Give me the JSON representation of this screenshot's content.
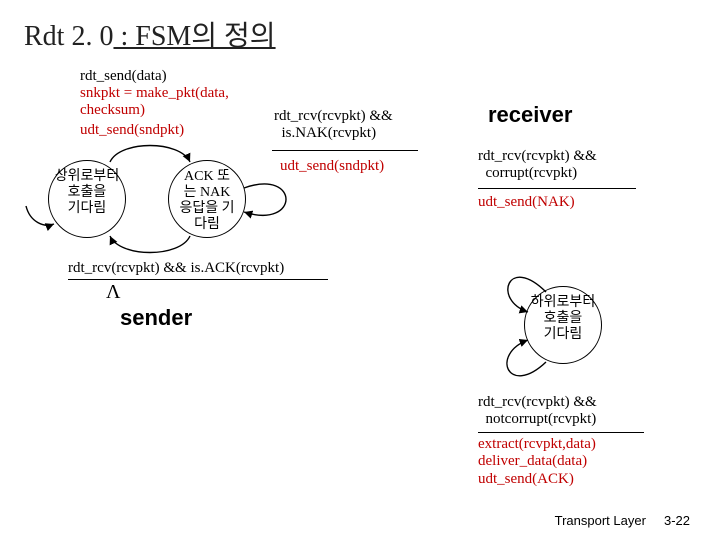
{
  "title": {
    "prefix": "Rdt 2. 0",
    "suffix": " : FSM의 정의"
  },
  "sender": {
    "label": "sender",
    "state1_lines": [
      "상위로부터",
      "호출을",
      "기다림"
    ],
    "state2_lines": [
      "ACK 또",
      "는 NAK",
      "응답을 기",
      "다림"
    ],
    "top_event": "rdt_send(data)",
    "top_action1": "snkpkt = make_pkt(data,\nchecksum)",
    "top_action2": "udt_send(sndpkt)",
    "right_event": "rdt_rcv(rcvpkt) &&\n  is.NAK(rcvpkt)",
    "right_action": "udt_send(sndpkt)",
    "bottom_event": "rdt_rcv(rcvpkt) && is.ACK(rcvpkt)",
    "lambda": "Λ"
  },
  "receiver": {
    "label": "receiver",
    "state_lines": [
      "하위로부터",
      "호출을",
      "기다림"
    ],
    "loop1_event": "rdt_rcv(rcvpkt) &&\n  corrupt(rcvpkt)",
    "loop1_action": "udt_send(NAK)",
    "loop2_event": "rdt_rcv(rcvpkt) &&\n  notcorrupt(rcvpkt)",
    "loop2_actions": "extract(rcvpkt,data)\ndeliver_data(data)\nudt_send(ACK)"
  },
  "footer": {
    "left": "Transport Layer",
    "right": "3-22"
  }
}
